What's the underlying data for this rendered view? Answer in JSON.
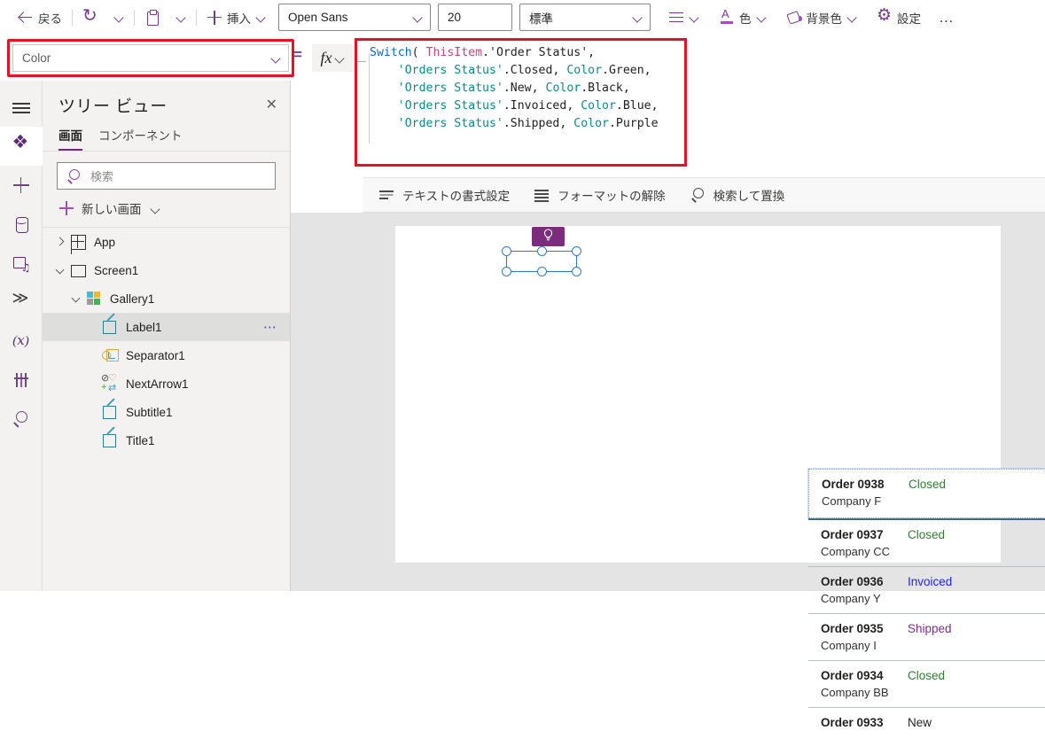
{
  "commandbar": {
    "back_label": "戻る",
    "insert_label": "挿入",
    "color_label": "色",
    "background_label": "背景色",
    "settings_label": "設定",
    "overflow_label": "…",
    "font_name": "Open Sans",
    "font_size": "20",
    "font_weight": "標準"
  },
  "property_bar": {
    "property_name": "Color",
    "equals": "=",
    "fx_label": "fx"
  },
  "formula": {
    "line1_fn": "Switch",
    "line1_paren": "(",
    "line1_this": "ThisItem",
    "line1_rest": ".'Order Status',",
    "line2_enum": "'Orders Status'",
    "line2_member": ".Closed, ",
    "line2_color": "Color",
    "line2_value": ".Green,",
    "line3_enum": "'Orders Status'",
    "line3_member": ".New, ",
    "line3_color": "Color",
    "line3_value": ".Black,",
    "line4_enum": "'Orders Status'",
    "line4_member": ".Invoiced, ",
    "line4_color": "Color",
    "line4_value": ".Blue,",
    "line5_enum": "'Orders Status'",
    "line5_member": ".Shipped, ",
    "line5_color": "Color",
    "line5_value": ".Purple",
    "line6_close": ")"
  },
  "format_toolbar": {
    "format_text": "テキストの書式設定",
    "clear_format": "フォーマットの解除",
    "find_replace": "検索して置換"
  },
  "tree_view": {
    "title": "ツリー ビュー",
    "tab_screens": "画面",
    "tab_components": "コンポーネント",
    "search_placeholder": "検索",
    "new_screen": "新しい画面",
    "nodes": [
      {
        "label": "App",
        "depth": 0,
        "icon": "app-icon",
        "twisty": "collapsed",
        "selected": false
      },
      {
        "label": "Screen1",
        "depth": 0,
        "icon": "screen-icon",
        "twisty": "expanded",
        "selected": false
      },
      {
        "label": "Gallery1",
        "depth": 1,
        "icon": "gallery-icon",
        "twisty": "expanded",
        "selected": false
      },
      {
        "label": "Label1",
        "depth": 2,
        "icon": "label-icon",
        "twisty": "none",
        "selected": true,
        "more": "⋯"
      },
      {
        "label": "Separator1",
        "depth": 2,
        "icon": "separator-icon",
        "twisty": "none",
        "selected": false
      },
      {
        "label": "NextArrow1",
        "depth": 2,
        "icon": "next-arrow-icon",
        "twisty": "none",
        "selected": false
      },
      {
        "label": "Subtitle1",
        "depth": 2,
        "icon": "label-icon",
        "twisty": "none",
        "selected": false
      },
      {
        "label": "Title1",
        "depth": 2,
        "icon": "label-icon",
        "twisty": "none",
        "selected": false
      }
    ]
  },
  "gallery": {
    "rows": [
      {
        "title": "Order 0938",
        "subtitle": "Company F",
        "status": "Closed",
        "status_color": "#2f7d32",
        "selected": true
      },
      {
        "title": "Order 0937",
        "subtitle": "Company CC",
        "status": "Closed",
        "status_color": "#2f7d32",
        "selected": false
      },
      {
        "title": "Order 0936",
        "subtitle": "Company Y",
        "status": "Invoiced",
        "status_color": "#2222ee",
        "selected": false
      },
      {
        "title": "Order 0935",
        "subtitle": "Company I",
        "status": "Shipped",
        "status_color": "#7b2d8e",
        "selected": false
      },
      {
        "title": "Order 0934",
        "subtitle": "Company BB",
        "status": "Closed",
        "status_color": "#2f7d32",
        "selected": false
      },
      {
        "title": "Order 0933",
        "subtitle": "",
        "status": "New",
        "status_color": "#1f1f1f",
        "selected": false
      }
    ],
    "lightbulb_glyph": "💡"
  },
  "colors": {
    "accent": "#742774",
    "highlight_red": "#e81123",
    "selection_blue": "#2f7ac7"
  }
}
